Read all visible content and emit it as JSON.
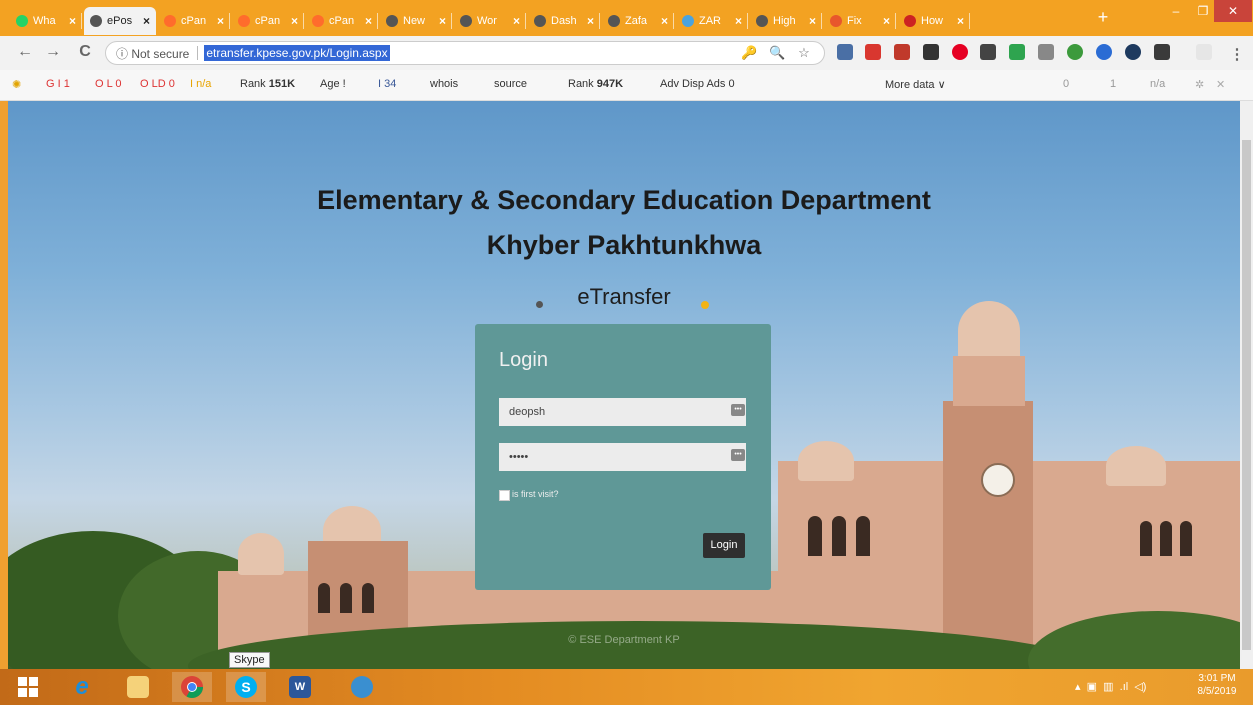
{
  "tabs": [
    {
      "label": "Wha",
      "color": "#25d366",
      "active": false
    },
    {
      "label": "ePos",
      "color": "#555555",
      "active": true
    },
    {
      "label": "cPan",
      "color": "#ff6c2c",
      "active": false
    },
    {
      "label": "cPan",
      "color": "#ff6c2c",
      "active": false
    },
    {
      "label": "cPan",
      "color": "#ff6c2c",
      "active": false
    },
    {
      "label": "New",
      "color": "#555555",
      "active": false
    },
    {
      "label": "Wor",
      "color": "#555555",
      "active": false
    },
    {
      "label": "Dash",
      "color": "#555555",
      "active": false
    },
    {
      "label": "Zafa",
      "color": "#555555",
      "active": false
    },
    {
      "label": "ZAR",
      "color": "#4aa3df",
      "active": false
    },
    {
      "label": "High",
      "color": "#555555",
      "active": false
    },
    {
      "label": "Fix",
      "color": "#e8572c",
      "active": false
    },
    {
      "label": "How",
      "color": "#cc2222",
      "active": false
    }
  ],
  "tab_close": "×",
  "new_tab": "+",
  "window": {
    "minimize": "–",
    "maximize": "❐",
    "close": "✕"
  },
  "nav": {
    "back": "←",
    "forward": "→",
    "reload": "C"
  },
  "address": {
    "security_text": "ⓘ Not secure",
    "url": "etransfer.kpese.gov.pk/Login.aspx"
  },
  "omni_icons": {
    "key": "🔑",
    "zoom": "🔍",
    "star": "☆"
  },
  "menu_icon": "⋮",
  "seobar": {
    "google": "G I 1",
    "links": "O L 0",
    "ld": "O LD 0",
    "bing": "I n/a",
    "rank1_label": "Rank",
    "rank1_value": "151K",
    "age": "Age !",
    "facebook": "I 34",
    "whois": "whois",
    "source": "source",
    "rank2_label": "Rank",
    "rank2_value": "947K",
    "adv": "Adv Disp Ads 0",
    "more_data": "More data ∨",
    "links_count": "0",
    "one": "1",
    "na": "n/a"
  },
  "page": {
    "title_line1": "Elementary & Secondary Education Department",
    "title_line2": "Khyber Pakhtunkhwa",
    "subtitle": "eTransfer",
    "login": {
      "heading": "Login",
      "username_value": "deopsh",
      "password_value": "•••••",
      "checkbox_label": "is first visit?",
      "button_label": "Login"
    },
    "footer": "© ESE Department KP"
  },
  "taskbar": {
    "tooltip": "Skype",
    "time": "3:01 PM",
    "date": "8/5/2019"
  },
  "colors": {
    "tabstrip": "#f3a222",
    "login_panel": "#5f9897",
    "login_button": "#2f2f2f",
    "accent_dot": "#f2b316"
  }
}
